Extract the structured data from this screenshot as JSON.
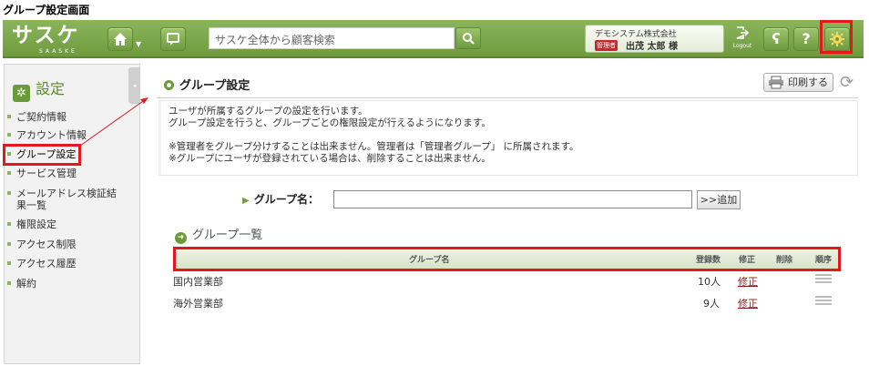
{
  "screen_caption": "グループ設定画面",
  "header": {
    "logo_text": "サスケ",
    "logo_sub": "SAASKE",
    "search_placeholder": "サスケ全体から顧客検索",
    "company": "デモシステム株式会社",
    "role_badge": "管理者",
    "user_name": "出茂 太郎 様",
    "logout_label": "Logout",
    "help_label": "?"
  },
  "sidebar": {
    "title": "設定",
    "collapse_label": "◂",
    "items": [
      {
        "label": "ご契約情報"
      },
      {
        "label": "アカウント情報"
      },
      {
        "label": "グループ設定"
      },
      {
        "label": "サービス管理"
      },
      {
        "label": "メールアドレス検証結",
        "label_cont": "果一覧"
      },
      {
        "label": "権限設定"
      },
      {
        "label": "アクセス制限"
      },
      {
        "label": "アクセス履歴"
      },
      {
        "label": "解約"
      }
    ]
  },
  "main": {
    "title": "グループ設定",
    "print_label": "印刷する",
    "description": [
      "ユーザが所属するグループの設定を行います。",
      "グループ設定を行うと、グループごとの権限設定が行えるようになります。",
      "",
      "※管理者をグループ分けすることは出来ません。管理者は「管理者グループ」 に所属されます。",
      "※グループにユーザが登録されている場合は、削除することは出来ません。"
    ],
    "form": {
      "label": "グループ名：",
      "input_value": "",
      "add_button": ">>追加"
    },
    "list": {
      "title": "グループ一覧",
      "columns": [
        "グループ名",
        "登録数",
        "修正",
        "削除",
        "順序"
      ],
      "rows": [
        {
          "name": "国内営業部",
          "count": "10人",
          "edit": "修正"
        },
        {
          "name": "海外営業部",
          "count": "9人",
          "edit": "修正"
        }
      ]
    }
  },
  "colors": {
    "accent_green": "#6f9a3e",
    "highlight_red": "#e1191f"
  }
}
